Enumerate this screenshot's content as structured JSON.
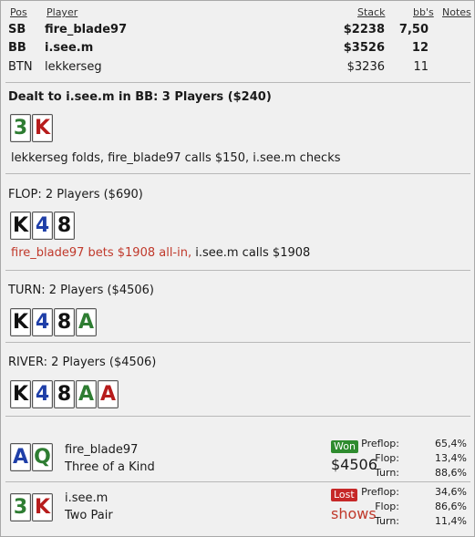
{
  "header": {
    "pos": "Pos",
    "player": "Player",
    "stack": "Stack",
    "bbs": "bb's",
    "notes": "Notes"
  },
  "players": [
    {
      "pos": "SB",
      "name": "fire_blade97",
      "stack": "$2238",
      "bb": "7,50"
    },
    {
      "pos": "BB",
      "name": "i.see.m",
      "stack": "$3526",
      "bb": "12"
    },
    {
      "pos": "BTN",
      "name": "lekkerseg",
      "stack": "$3236",
      "bb": "11"
    }
  ],
  "preflop": {
    "title": "Dealt to i.see.m in BB: 3 Players ($240)",
    "cards": [
      {
        "rank": "3",
        "suit": "clubs"
      },
      {
        "rank": "K",
        "suit": "diamonds"
      }
    ],
    "action": "lekkerseg folds, fire_blade97 calls $150, i.see.m checks"
  },
  "flop": {
    "title": "FLOP: 2 Players ($690)",
    "cards": [
      {
        "rank": "K",
        "suit": "spades"
      },
      {
        "rank": "4",
        "suit": "blue"
      },
      {
        "rank": "8",
        "suit": "spades"
      }
    ],
    "action_red": "fire_blade97 bets $1908 all-in,",
    "action_rest": " i.see.m calls $1908"
  },
  "turn": {
    "title": "TURN: 2 Players ($4506)",
    "cards": [
      {
        "rank": "K",
        "suit": "spades"
      },
      {
        "rank": "4",
        "suit": "blue"
      },
      {
        "rank": "8",
        "suit": "spades"
      },
      {
        "rank": "A",
        "suit": "clubs"
      }
    ]
  },
  "river": {
    "title": "RIVER: 2 Players ($4506)",
    "cards": [
      {
        "rank": "K",
        "suit": "spades"
      },
      {
        "rank": "4",
        "suit": "blue"
      },
      {
        "rank": "8",
        "suit": "spades"
      },
      {
        "rank": "A",
        "suit": "clubs"
      },
      {
        "rank": "A",
        "suit": "diamonds"
      }
    ]
  },
  "showdown": [
    {
      "name": "fire_blade97",
      "hand": "Three of a Kind",
      "cards": [
        {
          "rank": "A",
          "suit": "blue"
        },
        {
          "rank": "Q",
          "suit": "clubs"
        }
      ],
      "result": "Won",
      "amount": "$4506",
      "eq_labels": [
        "Preflop:",
        "Flop:",
        "Turn:"
      ],
      "eq_values": [
        "65,4%",
        "13,4%",
        "88,6%"
      ]
    },
    {
      "name": "i.see.m",
      "hand": "Two Pair",
      "cards": [
        {
          "rank": "3",
          "suit": "clubs"
        },
        {
          "rank": "K",
          "suit": "diamonds"
        }
      ],
      "result": "Lost",
      "amount": "shows",
      "eq_labels": [
        "Preflop:",
        "Flop:",
        "Turn:"
      ],
      "eq_values": [
        "34,6%",
        "86,6%",
        "11,4%"
      ]
    }
  ],
  "colors": {
    "clubs": "#2e7d32",
    "diamonds": "#b71c1c",
    "spades": "#111111",
    "blue": "#1f3fa8",
    "won": "#2e8b2e",
    "lost": "#c62828"
  }
}
